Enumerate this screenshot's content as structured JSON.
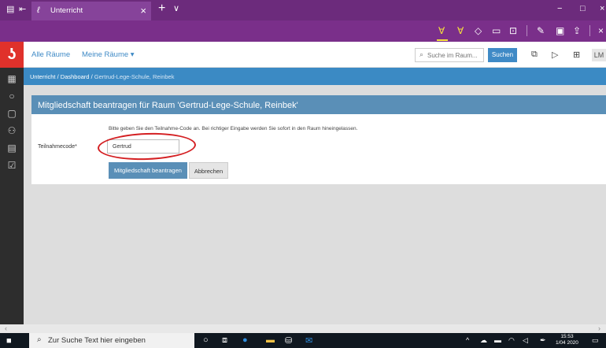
{
  "browser": {
    "tab_title": "Unterricht",
    "tab_close": "×",
    "new_tab": "+",
    "tab_menu": "∨",
    "minimize": "−",
    "maximize": "□",
    "close": "×"
  },
  "header": {
    "nav_all_rooms": "Alle Räume",
    "nav_my_rooms": "Meine Räume ▾",
    "search_placeholder": "Suche im Raum...",
    "search_button": "Suchen",
    "avatar": "LM"
  },
  "breadcrumb": {
    "part1": "Unterricht",
    "sep1": " / ",
    "part2": "Dashboard",
    "sep2": " / ",
    "current": "Gertrud-Lege-Schule, Reinbek"
  },
  "panel": {
    "title": "Mitgliedschaft beantragen für Raum 'Gertrud-Lege-Schule, Reinbek'",
    "hint": "Bitte geben Sie den Teilnahme-Code an. Bei richtiger Eingabe werden Sie sofort in den Raum hineingelassen.",
    "field_label": "Teilnahmecode*",
    "field_value": "Gertrud",
    "submit": "Mitgliedschaft beantragen",
    "cancel": "Abbrechen"
  },
  "taskbar": {
    "search_placeholder": "Zur Suche Text hier eingeben",
    "time": "15:53",
    "date": "1/04 2020"
  },
  "colors": {
    "browser_purple": "#6c2b7c",
    "brand_red": "#e0312b",
    "link_blue": "#3f8ac6",
    "panel_blue": "#5a8fb7",
    "annotation_red": "#d41f22"
  }
}
